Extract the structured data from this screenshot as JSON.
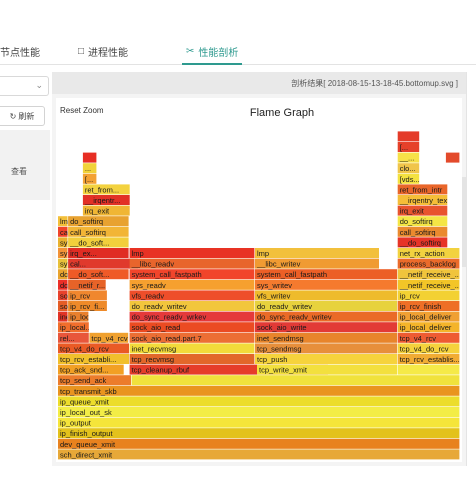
{
  "tabs": [
    {
      "label": "节点性能",
      "icon": "node-icon",
      "active": false
    },
    {
      "label": "进程性能",
      "icon": "document-icon",
      "active": false
    },
    {
      "label": "性能剖析",
      "icon": "scissors-icon",
      "active": true
    }
  ],
  "sidebar": {
    "refresh_label": "刷新",
    "view_label": "查看"
  },
  "file_info": "剖析结果[ 2018-08-15-13-18-45.bottomup.svg ]",
  "flame": {
    "title": "Flame Graph",
    "reset_label": "Reset Zoom",
    "frames": [
      {
        "x": 0,
        "w": 1,
        "d": 0,
        "c": "#e7a838",
        "n": "sch_direct_xmit"
      },
      {
        "x": 0,
        "w": 1,
        "d": 1,
        "c": "#e8821e",
        "n": "dev_queue_xmit"
      },
      {
        "x": 0,
        "w": 1,
        "d": 2,
        "c": "#e3c21b",
        "n": "ip_finish_output"
      },
      {
        "x": 0,
        "w": 1,
        "d": 3,
        "c": "#f5e53a",
        "n": "ip_output"
      },
      {
        "x": 0,
        "w": 1,
        "d": 4,
        "c": "#f3ed46",
        "n": "ip_local_out_sk"
      },
      {
        "x": 0,
        "w": 1,
        "d": 5,
        "c": "#ecdd2b",
        "n": "ip_queue_xmit"
      },
      {
        "x": 0,
        "w": 1,
        "d": 6,
        "c": "#e9941f",
        "n": "tcp_transmit_skb"
      },
      {
        "x": 0,
        "w": 0.183,
        "d": 7,
        "c": "#ec7c2b",
        "n": "tcp_send_ack"
      },
      {
        "x": 0.183,
        "w": 0.817,
        "d": 7,
        "c": "#f0e23c",
        "n": ""
      },
      {
        "x": 0,
        "w": 0.165,
        "d": 8,
        "c": "#f2a024",
        "n": "tcp_ack_snd..."
      },
      {
        "x": 0.178,
        "w": 0.495,
        "d": 8,
        "c": "#e63d2a",
        "n": "tcp_cleanup_rbuf"
      },
      {
        "x": 0.495,
        "w": 0.35,
        "d": 8,
        "c": "#f3e03e",
        "n": "tcp_write_xmit"
      },
      {
        "x": 0.845,
        "w": 0.155,
        "d": 8,
        "c": "#f5ea48",
        "n": ""
      },
      {
        "x": 0,
        "w": 0.178,
        "d": 9,
        "c": "#f1c02c",
        "n": "tcp_rcv_establi..."
      },
      {
        "x": 0.178,
        "w": 0.312,
        "d": 9,
        "c": "#e2672a",
        "n": "tcp_recvmsg"
      },
      {
        "x": 0.49,
        "w": 0.355,
        "d": 9,
        "c": "#f6d33c",
        "n": "tcp_push"
      },
      {
        "x": 0.845,
        "w": 0.155,
        "d": 9,
        "c": "#f1ac34",
        "n": "tcp_rcv_establis..."
      },
      {
        "x": 0,
        "w": 0.178,
        "d": 10,
        "c": "#ea5a25",
        "n": "tcp_v4_do_rcv"
      },
      {
        "x": 0.178,
        "w": 0.312,
        "d": 10,
        "c": "#f2da3a",
        "n": "inet_recvmsg"
      },
      {
        "x": 0.49,
        "w": 0.355,
        "d": 10,
        "c": "#e78f3b",
        "n": "tcp_sendmsg"
      },
      {
        "x": 0.845,
        "w": 0.155,
        "d": 10,
        "c": "#f5d23c",
        "n": "tcp_v4_do_rcv"
      },
      {
        "x": 0,
        "w": 0.078,
        "d": 11,
        "c": "#e8563b",
        "n": "rel..."
      },
      {
        "x": 0.078,
        "w": 0.098,
        "d": 11,
        "c": "#f0a12f",
        "n": "tcp_v4_rcv"
      },
      {
        "x": 0.178,
        "w": 0.312,
        "d": 11,
        "c": "#ec6e34",
        "n": "sock_aio_read.part.7"
      },
      {
        "x": 0.49,
        "w": 0.355,
        "d": 11,
        "c": "#e8852b",
        "n": "inet_sendmsg"
      },
      {
        "x": 0.845,
        "w": 0.155,
        "d": 11,
        "c": "#ee5b32",
        "n": "tcp_v4_rcv"
      },
      {
        "x": 0,
        "w": 0.078,
        "d": 12,
        "c": "#f16e2c",
        "n": "ip_local..."
      },
      {
        "x": 0.178,
        "w": 0.312,
        "d": 12,
        "c": "#eb4b22",
        "n": "sock_aio_read"
      },
      {
        "x": 0.49,
        "w": 0.355,
        "d": 12,
        "c": "#e23a36",
        "n": "sock_aio_write"
      },
      {
        "x": 0.845,
        "w": 0.155,
        "d": 12,
        "c": "#f4b42a",
        "n": "ip_local_deliver"
      },
      {
        "x": 0,
        "w": 0.025,
        "d": 13,
        "c": "#e13326",
        "n": "ine..."
      },
      {
        "x": 0.025,
        "w": 0.052,
        "d": 13,
        "c": "#e9802d",
        "n": "ip_local_..."
      },
      {
        "x": 0.178,
        "w": 0.312,
        "d": 13,
        "c": "#e5393a",
        "n": "do_sync_readv_wrkev"
      },
      {
        "x": 0.49,
        "w": 0.355,
        "d": 13,
        "c": "#ea6a27",
        "n": "do_sync_readv_writev"
      },
      {
        "x": 0.845,
        "w": 0.155,
        "d": 13,
        "c": "#f0a033",
        "n": "ip_local_deliver"
      },
      {
        "x": 0,
        "w": 0.025,
        "d": 14,
        "c": "#e45d26",
        "n": "soc..."
      },
      {
        "x": 0.025,
        "w": 0.098,
        "d": 14,
        "c": "#ee8a29",
        "n": "ip_rcv_fi..."
      },
      {
        "x": 0.178,
        "w": 0.312,
        "d": 14,
        "c": "#f2c63c",
        "n": "do_readv_writev"
      },
      {
        "x": 0.49,
        "w": 0.355,
        "d": 14,
        "c": "#e7d23d",
        "n": "do_readv_writev"
      },
      {
        "x": 0.845,
        "w": 0.155,
        "d": 14,
        "c": "#ee6f26",
        "n": "ip_rcv_finish"
      },
      {
        "x": 0,
        "w": 0.025,
        "d": 15,
        "c": "#e8422c",
        "n": "so..."
      },
      {
        "x": 0.025,
        "w": 0.098,
        "d": 15,
        "c": "#f0872e",
        "n": "ip_rcv"
      },
      {
        "x": 0.178,
        "w": 0.312,
        "d": 15,
        "c": "#ee4e2a",
        "n": "vfs_readv"
      },
      {
        "x": 0.49,
        "w": 0.355,
        "d": 15,
        "c": "#eebb2c",
        "n": "vfs_writev"
      },
      {
        "x": 0.845,
        "w": 0.155,
        "d": 15,
        "c": "#f3d133",
        "n": "ip_rcv"
      },
      {
        "x": 0,
        "w": 0.025,
        "d": 16,
        "c": "#eb2f27",
        "n": "do..."
      },
      {
        "x": 0.025,
        "w": 0.095,
        "d": 16,
        "c": "#e76328",
        "n": "__netif_r..."
      },
      {
        "x": 0.178,
        "w": 0.312,
        "d": 16,
        "c": "#f6a02f",
        "n": "sys_readv"
      },
      {
        "x": 0.49,
        "w": 0.355,
        "d": 16,
        "c": "#f57a2e",
        "n": "sys_writev"
      },
      {
        "x": 0.845,
        "w": 0.155,
        "d": 16,
        "c": "#f3c527",
        "n": "__netif_receive_..."
      },
      {
        "x": 0,
        "w": 0.025,
        "d": 17,
        "c": "#e9a42e",
        "n": "do..."
      },
      {
        "x": 0.025,
        "w": 0.152,
        "d": 17,
        "c": "#ef5a27",
        "n": "__do_soft..."
      },
      {
        "x": 0.178,
        "w": 0.312,
        "d": 17,
        "c": "#f1452b",
        "n": "system_call_fastpath"
      },
      {
        "x": 0.49,
        "w": 0.355,
        "d": 17,
        "c": "#ec5f26",
        "n": "system_call_fastpath"
      },
      {
        "x": 0.845,
        "w": 0.155,
        "d": 17,
        "c": "#f0c43c",
        "n": "__netif_receive_..."
      },
      {
        "x": 0,
        "w": 0.025,
        "d": 18,
        "c": "#e8c13a",
        "n": "sys..."
      },
      {
        "x": 0.025,
        "w": 0.175,
        "d": 18,
        "c": "#e03a2c",
        "n": "cal..."
      },
      {
        "x": 0.178,
        "w": 0.312,
        "d": 18,
        "c": "#e8652c",
        "n": "__libc_readv"
      },
      {
        "x": 0.49,
        "w": 0.31,
        "d": 18,
        "c": "#f09b32",
        "n": "__libc_writev"
      },
      {
        "x": 0.845,
        "w": 0.155,
        "d": 18,
        "c": "#eb6b2a",
        "n": "process_backlog"
      },
      {
        "x": 0,
        "w": 0.025,
        "d": 19,
        "c": "#f39337",
        "n": "sys..."
      },
      {
        "x": 0.025,
        "w": 0.152,
        "d": 19,
        "c": "#e02c23",
        "n": "irq_ex..."
      },
      {
        "x": 0.178,
        "w": 0.312,
        "d": 19,
        "c": "#e83224",
        "n": "lmp"
      },
      {
        "x": 0.49,
        "w": 0.31,
        "d": 19,
        "c": "#f2c03c",
        "n": "lmp"
      },
      {
        "x": 0.845,
        "w": 0.155,
        "d": 19,
        "c": "#f2d23f",
        "n": "net_rx_action"
      },
      {
        "x": 0,
        "w": 0.025,
        "d": 20,
        "c": "#e8b22e",
        "n": "sys..."
      },
      {
        "x": 0.025,
        "w": 0.152,
        "d": 20,
        "c": "#f2cf3c",
        "n": "__do_soft..."
      },
      {
        "x": 0.845,
        "w": 0.125,
        "d": 20,
        "c": "#e73427",
        "n": "__do_softirq"
      },
      {
        "x": 0,
        "w": 0.025,
        "d": 21,
        "c": "#f0442a",
        "n": "call..."
      },
      {
        "x": 0.025,
        "w": 0.152,
        "d": 21,
        "c": "#f2b536",
        "n": "call_softirq"
      },
      {
        "x": 0.845,
        "w": 0.125,
        "d": 21,
        "c": "#ea8a2e",
        "n": "call_softirq"
      },
      {
        "x": 0,
        "w": 0.025,
        "d": 22,
        "c": "#f3c03a",
        "n": "lmp"
      },
      {
        "x": 0.025,
        "w": 0.152,
        "d": 22,
        "c": "#e8a230",
        "n": "do_softirq"
      },
      {
        "x": 0.845,
        "w": 0.125,
        "d": 22,
        "c": "#f4e645",
        "n": "do_softirq"
      },
      {
        "x": 0.062,
        "w": 0.118,
        "d": 23,
        "c": "#f0b634",
        "n": "irq_exit"
      },
      {
        "x": 0.845,
        "w": 0.125,
        "d": 23,
        "c": "#e8542e",
        "n": "irq_exit"
      },
      {
        "x": 0.062,
        "w": 0.118,
        "d": 24,
        "c": "#e23126",
        "n": "__irqentr..."
      },
      {
        "x": 0.845,
        "w": 0.125,
        "d": 24,
        "c": "#f5be38",
        "n": "__irqentry_text_..."
      },
      {
        "x": 0.062,
        "w": 0.118,
        "d": 25,
        "c": "#f3d23f",
        "n": "ret_from..."
      },
      {
        "x": 0.845,
        "w": 0.125,
        "d": 25,
        "c": "#e9662a",
        "n": "ret_from_intr"
      },
      {
        "x": 0.062,
        "w": 0.035,
        "d": 26,
        "c": "#f3a134",
        "n": "[..."
      },
      {
        "x": 0.845,
        "w": 0.055,
        "d": 26,
        "c": "#f4e240",
        "n": "[vds..."
      },
      {
        "x": 0.062,
        "w": 0.035,
        "d": 27,
        "c": "#f1d23a",
        "n": "..."
      },
      {
        "x": 0.845,
        "w": 0.055,
        "d": 27,
        "c": "#f0c54a",
        "n": "clo..."
      },
      {
        "x": 0.062,
        "w": 0.035,
        "d": 28,
        "c": "#e72e24",
        "n": ""
      },
      {
        "x": 0.845,
        "w": 0.055,
        "d": 28,
        "c": "#f7e148",
        "n": "__..."
      },
      {
        "x": 0.845,
        "w": 0.055,
        "d": 29,
        "c": "#e6412a",
        "n": "[..."
      },
      {
        "x": 0.845,
        "w": 0.055,
        "d": 30,
        "c": "#e43b29",
        "n": ""
      },
      {
        "x": 0.965,
        "w": 0.035,
        "d": 28,
        "c": "#e34a2b",
        "n": ""
      }
    ]
  }
}
